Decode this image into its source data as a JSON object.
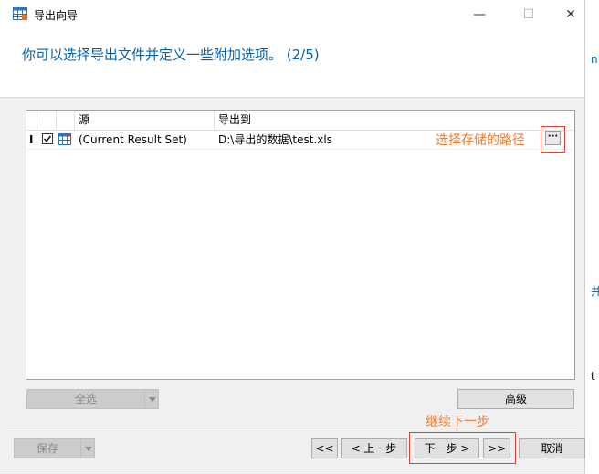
{
  "window": {
    "title": "导出向导",
    "minimize_glyph": "—",
    "maximize_glyph": "☐",
    "close_glyph": "✕"
  },
  "header": {
    "text": "你可以选择导出文件并定义一些附加选项。 (2/5)"
  },
  "grid": {
    "columns": {
      "source": "源",
      "export_to": "导出到"
    },
    "rows": [
      {
        "marker": "I",
        "checked": true,
        "source": "(Current Result Set)",
        "export_to": "D:\\导出的数据\\test.xls"
      }
    ],
    "browse_label": "···"
  },
  "annotations": {
    "choose_path": "选择存储的路径",
    "next_step": "继续下一步"
  },
  "buttons": {
    "select_all": "全选",
    "advanced": "高级",
    "save": "保存",
    "first": "<<",
    "prev": "< 上一步",
    "next": "下一步 >",
    "last": ">>",
    "cancel": "取消"
  },
  "background_fragments": [
    "n",
    "并",
    "t"
  ],
  "colors": {
    "header_text": "#0063b1",
    "annotation_text": "#ed7d31",
    "annotation_border": "#e04030"
  }
}
